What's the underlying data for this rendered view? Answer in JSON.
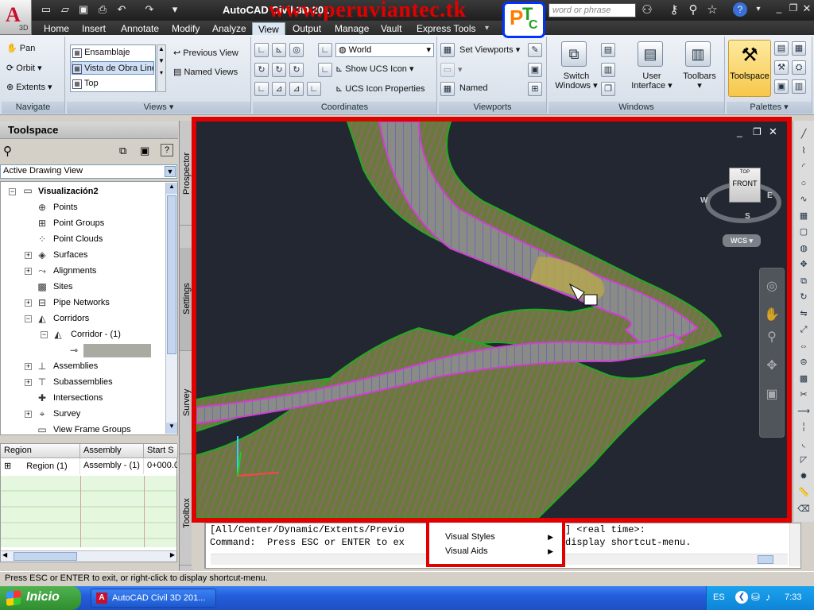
{
  "window": {
    "app_button_suffix": "3D",
    "title": "AutoCAD Civil 3D 201",
    "watermark": "www.peruviantec.tk",
    "logo": {
      "letters": [
        "P",
        "T",
        "C"
      ]
    },
    "search_placeholder": "word or phrase",
    "title_icons": [
      "binoculars-icon",
      "key-icon",
      "star-icon",
      "help-icon"
    ],
    "controls": [
      "minimize-icon",
      "restore-icon",
      "close-icon"
    ]
  },
  "ribbon": {
    "tabs": [
      "Home",
      "Insert",
      "Annotate",
      "Modify",
      "Analyze",
      "View",
      "Output",
      "Manage",
      "Vault",
      "Express Tools"
    ],
    "active_tab": "View",
    "navigate": {
      "title": "Navigate",
      "pan": "Pan",
      "orbit": "Orbit",
      "extents": "Extents"
    },
    "views": {
      "title": "Views",
      "items": [
        "Ensamblaje",
        "Vista de Obra Line",
        "Top"
      ],
      "previous": "Previous View",
      "named": "Named Views"
    },
    "coordinates": {
      "title": "Coordinates",
      "world": "World",
      "show_ucs": "Show UCS Icon",
      "ucs_props": "UCS Icon Properties"
    },
    "viewports": {
      "title": "Viewports",
      "set": "Set Viewports",
      "named": "Named"
    },
    "windows": {
      "title": "Windows",
      "switch": "Switch Windows",
      "user_interface": "User Interface",
      "toolbars": "Toolbars"
    },
    "palettes": {
      "title": "Palettes",
      "toolspace": "Toolspace"
    }
  },
  "toolspace": {
    "title": "Toolspace",
    "view_select": "Active Drawing View",
    "drawing": "Visualización2",
    "tree": [
      {
        "label": "Points",
        "expandable": false,
        "indent": 1,
        "icon": "points-icon"
      },
      {
        "label": "Point Groups",
        "expandable": false,
        "indent": 1,
        "icon": "point-groups-icon"
      },
      {
        "label": "Point Clouds",
        "expandable": false,
        "indent": 1,
        "icon": "point-clouds-icon"
      },
      {
        "label": "Surfaces",
        "expandable": true,
        "indent": 1,
        "icon": "surfaces-icon"
      },
      {
        "label": "Alignments",
        "expandable": true,
        "indent": 1,
        "icon": "alignments-icon"
      },
      {
        "label": "Sites",
        "expandable": false,
        "indent": 1,
        "icon": "sites-icon"
      },
      {
        "label": "Pipe Networks",
        "expandable": true,
        "indent": 1,
        "icon": "pipe-networks-icon"
      },
      {
        "label": "Corridors",
        "expandable": true,
        "expanded": true,
        "indent": 1,
        "icon": "corridors-icon"
      },
      {
        "label": "Corridor - (1)",
        "expandable": true,
        "expanded": true,
        "indent": 2,
        "icon": "corridor-icon"
      },
      {
        "label": "",
        "expandable": false,
        "indent": 3,
        "icon": "baseline-icon",
        "selected": true
      },
      {
        "label": "Assemblies",
        "expandable": true,
        "indent": 1,
        "icon": "assemblies-icon"
      },
      {
        "label": "Subassemblies",
        "expandable": true,
        "indent": 1,
        "icon": "subassemblies-icon"
      },
      {
        "label": "Intersections",
        "expandable": false,
        "indent": 1,
        "icon": "intersections-icon"
      },
      {
        "label": "Survey",
        "expandable": true,
        "indent": 1,
        "icon": "survey-icon"
      },
      {
        "label": "View Frame Groups",
        "expandable": false,
        "indent": 1,
        "icon": "view-frame-groups-icon"
      }
    ],
    "side_tabs": [
      "Prospector",
      "Settings",
      "Survey",
      "Toolbox"
    ],
    "grid": {
      "columns": [
        "Region",
        "Assembly",
        "Start S"
      ],
      "rows": [
        [
          "Region (1)",
          "Assembly - (1)",
          "0+000.0"
        ]
      ]
    }
  },
  "viewport": {
    "viewcube": {
      "top": "TOP",
      "front": "FRONT",
      "compass": {
        "w": "W",
        "e": "E",
        "s": "S"
      }
    },
    "wcs": "WCS",
    "controls": [
      "minimize-icon",
      "restore-icon",
      "close-icon"
    ]
  },
  "command": {
    "line1": "[All/Center/Dynamic/Extents/Previo",
    "line1_right": "] <real time>:",
    "line2": "Command:  Press ESC or ENTER to ex",
    "line2_right": "display shortcut-menu."
  },
  "context_menu": {
    "items": [
      "Visual Styles",
      "Visual Aids"
    ]
  },
  "statusbar": {
    "text": "Press ESC or ENTER to exit, or right-click to display shortcut-menu."
  },
  "taskbar": {
    "start": "Inicio",
    "item": "AutoCAD Civil 3D 201...",
    "lang": "ES",
    "time": "7:33"
  }
}
